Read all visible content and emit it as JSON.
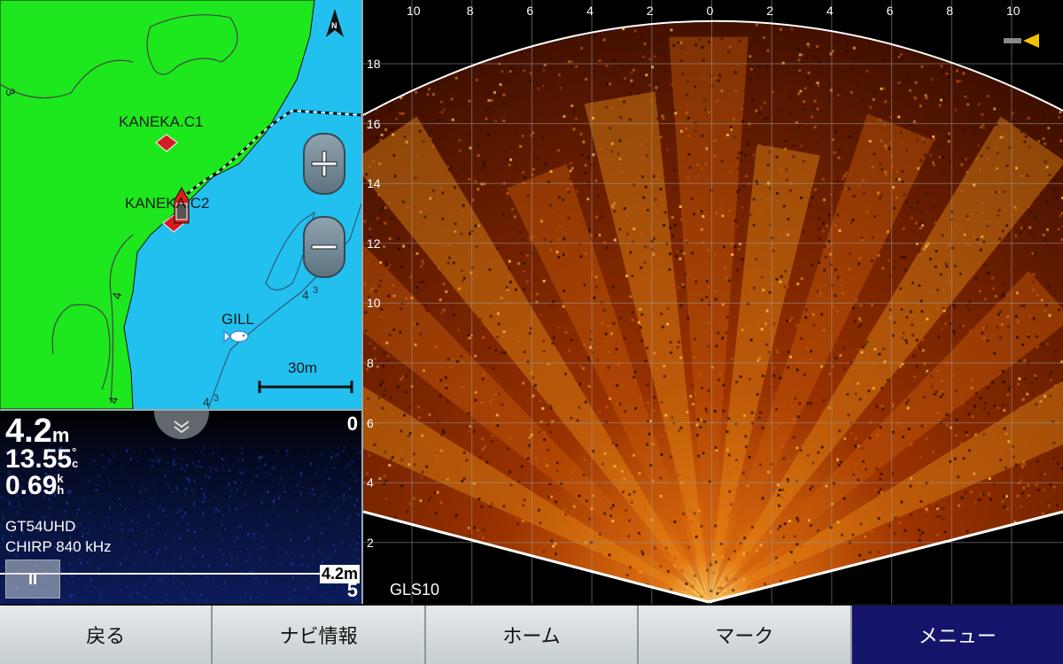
{
  "chart": {
    "waypoints": [
      {
        "name": "KANEKA.C1"
      },
      {
        "name": "KANEKA.C2"
      },
      {
        "name": "GILL"
      }
    ],
    "depth_contour_labels": [
      "3",
      "4",
      "4",
      "4",
      "3",
      "4",
      "3"
    ],
    "scale_label": "30m",
    "north_label": "N",
    "zoom_in_label": "+",
    "zoom_out_label": "−",
    "colors": {
      "land": "#1de81d",
      "water": "#22c0ef",
      "waypoint": "#d31d24"
    }
  },
  "sonar": {
    "depth": {
      "value": "4.2",
      "unit": "m"
    },
    "temperature": {
      "value": "13.55",
      "unit_top": "°",
      "unit_bottom": "c"
    },
    "speed": {
      "value": "0.69",
      "unit_top": "k",
      "unit_bottom": "h"
    },
    "transducer": "GT54UHD",
    "frequency": "CHIRP 840 kHz",
    "range_top": "0",
    "range_bottom": "5",
    "depth_line_tag": "4.2m",
    "pause_label": "II"
  },
  "livesight": {
    "label": "GLS10",
    "x_ticks": [
      "10",
      "8",
      "6",
      "4",
      "2",
      "0",
      "2",
      "4",
      "6",
      "8",
      "10"
    ],
    "y_ticks": [
      "18",
      "16",
      "14",
      "12",
      "10",
      "8",
      "6",
      "4",
      "2"
    ],
    "colors": {
      "echo_low": "#3a0d00",
      "echo_mid": "#b84500",
      "echo_high": "#ffcc22"
    }
  },
  "softkeys": [
    {
      "label": "戻る"
    },
    {
      "label": "ナビ情報"
    },
    {
      "label": "ホーム"
    },
    {
      "label": "マーク"
    },
    {
      "label": "メニュー",
      "active": true
    }
  ]
}
